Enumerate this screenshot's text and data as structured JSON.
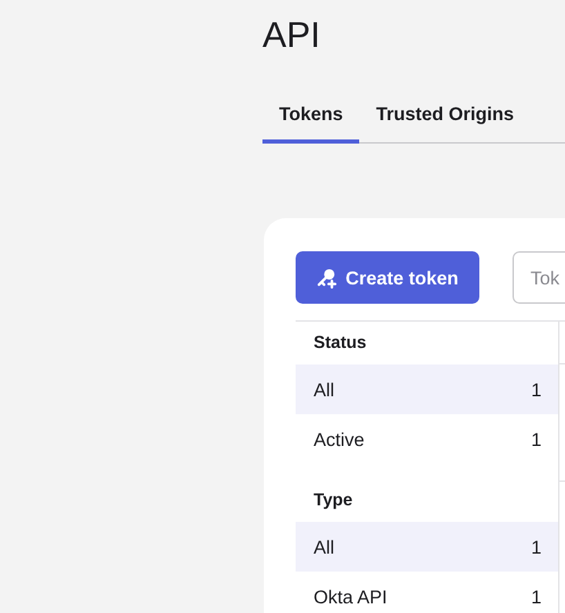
{
  "page": {
    "title": "API"
  },
  "tabs": [
    {
      "label": "Tokens",
      "selected": true
    },
    {
      "label": "Trusted Origins",
      "selected": false
    }
  ],
  "toolbar": {
    "create_button": "Create token",
    "search": {
      "placeholder": "Tok"
    }
  },
  "filters": [
    {
      "heading": "Status",
      "options": [
        {
          "label": "All",
          "count": "1",
          "selected": true
        },
        {
          "label": "Active",
          "count": "1",
          "selected": false
        }
      ]
    },
    {
      "heading": "Type",
      "options": [
        {
          "label": "All",
          "count": "1",
          "selected": true
        },
        {
          "label": "Okta API",
          "count": "1",
          "selected": false
        }
      ]
    }
  ]
}
